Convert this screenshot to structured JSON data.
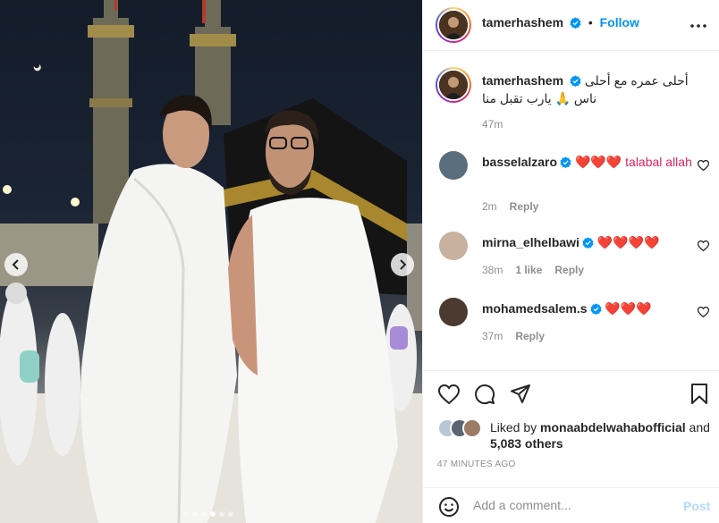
{
  "post": {
    "username": "tamerhashem",
    "follow_label": "Follow",
    "caption_text": "أحلى عمره مع أحلى ناس 🙏 يارب تقبل منا",
    "caption_time": "47m",
    "carousel": {
      "total": 6,
      "active_index": 3
    }
  },
  "comments": [
    {
      "username": "basselalzaro",
      "text": "❤️❤️❤️ talabal allah",
      "time": "2m",
      "likes": "",
      "reply_label": "Reply"
    },
    {
      "username": "mirna_elhelbawi",
      "text": "❤️❤️❤️❤️",
      "time": "38m",
      "likes": "1 like",
      "reply_label": "Reply"
    },
    {
      "username": "mohamedsalem.s",
      "text": "❤️❤️❤️",
      "time": "37m",
      "likes": "",
      "reply_label": "Reply"
    }
  ],
  "likes": {
    "liked_by_prefix": "Liked by",
    "liked_by_user": "monaabdelwahabofficial",
    "and_label": "and",
    "others_count": "5,083 others"
  },
  "timestamp": "47 MINUTES AGO",
  "composer": {
    "placeholder": "Add a comment...",
    "post_label": "Post"
  },
  "icons": {
    "more": "more-options-icon",
    "like": "heart-icon",
    "comment": "comment-icon",
    "share": "share-icon",
    "save": "bookmark-icon",
    "emoji": "emoji-icon",
    "prev": "chevron-left-icon",
    "next": "chevron-right-icon",
    "verified": "verified-badge-icon"
  },
  "colors": {
    "link": "#0095f6",
    "verified": "#0095f6",
    "heart": "#e0245e",
    "muted": "#8e8e8e"
  }
}
